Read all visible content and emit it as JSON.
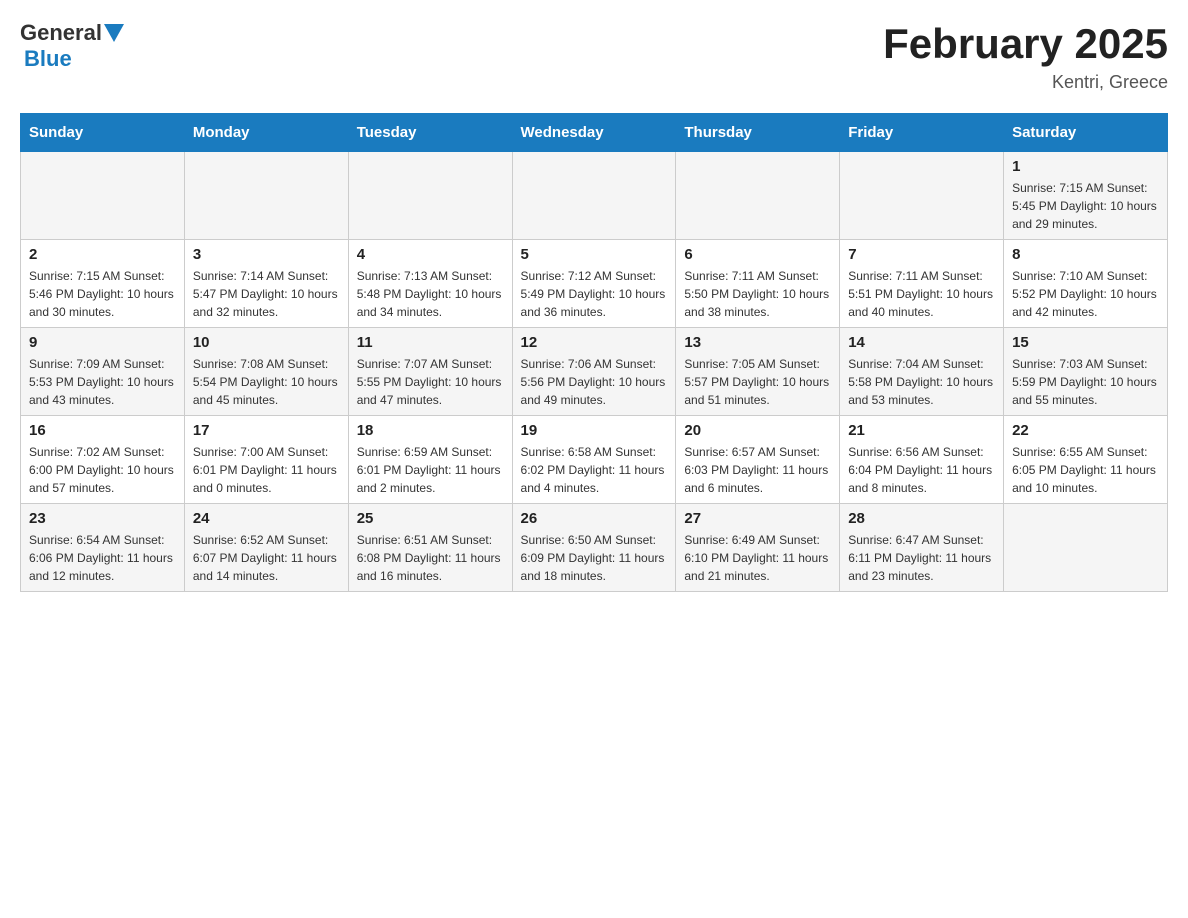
{
  "header": {
    "logo": {
      "text_general": "General",
      "text_blue": "Blue",
      "arrow": "▲"
    },
    "title": "February 2025",
    "location": "Kentri, Greece"
  },
  "calendar": {
    "days_of_week": [
      "Sunday",
      "Monday",
      "Tuesday",
      "Wednesday",
      "Thursday",
      "Friday",
      "Saturday"
    ],
    "weeks": [
      {
        "days": [
          {
            "number": "",
            "info": ""
          },
          {
            "number": "",
            "info": ""
          },
          {
            "number": "",
            "info": ""
          },
          {
            "number": "",
            "info": ""
          },
          {
            "number": "",
            "info": ""
          },
          {
            "number": "",
            "info": ""
          },
          {
            "number": "1",
            "info": "Sunrise: 7:15 AM\nSunset: 5:45 PM\nDaylight: 10 hours and 29 minutes."
          }
        ]
      },
      {
        "days": [
          {
            "number": "2",
            "info": "Sunrise: 7:15 AM\nSunset: 5:46 PM\nDaylight: 10 hours and 30 minutes."
          },
          {
            "number": "3",
            "info": "Sunrise: 7:14 AM\nSunset: 5:47 PM\nDaylight: 10 hours and 32 minutes."
          },
          {
            "number": "4",
            "info": "Sunrise: 7:13 AM\nSunset: 5:48 PM\nDaylight: 10 hours and 34 minutes."
          },
          {
            "number": "5",
            "info": "Sunrise: 7:12 AM\nSunset: 5:49 PM\nDaylight: 10 hours and 36 minutes."
          },
          {
            "number": "6",
            "info": "Sunrise: 7:11 AM\nSunset: 5:50 PM\nDaylight: 10 hours and 38 minutes."
          },
          {
            "number": "7",
            "info": "Sunrise: 7:11 AM\nSunset: 5:51 PM\nDaylight: 10 hours and 40 minutes."
          },
          {
            "number": "8",
            "info": "Sunrise: 7:10 AM\nSunset: 5:52 PM\nDaylight: 10 hours and 42 minutes."
          }
        ]
      },
      {
        "days": [
          {
            "number": "9",
            "info": "Sunrise: 7:09 AM\nSunset: 5:53 PM\nDaylight: 10 hours and 43 minutes."
          },
          {
            "number": "10",
            "info": "Sunrise: 7:08 AM\nSunset: 5:54 PM\nDaylight: 10 hours and 45 minutes."
          },
          {
            "number": "11",
            "info": "Sunrise: 7:07 AM\nSunset: 5:55 PM\nDaylight: 10 hours and 47 minutes."
          },
          {
            "number": "12",
            "info": "Sunrise: 7:06 AM\nSunset: 5:56 PM\nDaylight: 10 hours and 49 minutes."
          },
          {
            "number": "13",
            "info": "Sunrise: 7:05 AM\nSunset: 5:57 PM\nDaylight: 10 hours and 51 minutes."
          },
          {
            "number": "14",
            "info": "Sunrise: 7:04 AM\nSunset: 5:58 PM\nDaylight: 10 hours and 53 minutes."
          },
          {
            "number": "15",
            "info": "Sunrise: 7:03 AM\nSunset: 5:59 PM\nDaylight: 10 hours and 55 minutes."
          }
        ]
      },
      {
        "days": [
          {
            "number": "16",
            "info": "Sunrise: 7:02 AM\nSunset: 6:00 PM\nDaylight: 10 hours and 57 minutes."
          },
          {
            "number": "17",
            "info": "Sunrise: 7:00 AM\nSunset: 6:01 PM\nDaylight: 11 hours and 0 minutes."
          },
          {
            "number": "18",
            "info": "Sunrise: 6:59 AM\nSunset: 6:01 PM\nDaylight: 11 hours and 2 minutes."
          },
          {
            "number": "19",
            "info": "Sunrise: 6:58 AM\nSunset: 6:02 PM\nDaylight: 11 hours and 4 minutes."
          },
          {
            "number": "20",
            "info": "Sunrise: 6:57 AM\nSunset: 6:03 PM\nDaylight: 11 hours and 6 minutes."
          },
          {
            "number": "21",
            "info": "Sunrise: 6:56 AM\nSunset: 6:04 PM\nDaylight: 11 hours and 8 minutes."
          },
          {
            "number": "22",
            "info": "Sunrise: 6:55 AM\nSunset: 6:05 PM\nDaylight: 11 hours and 10 minutes."
          }
        ]
      },
      {
        "days": [
          {
            "number": "23",
            "info": "Sunrise: 6:54 AM\nSunset: 6:06 PM\nDaylight: 11 hours and 12 minutes."
          },
          {
            "number": "24",
            "info": "Sunrise: 6:52 AM\nSunset: 6:07 PM\nDaylight: 11 hours and 14 minutes."
          },
          {
            "number": "25",
            "info": "Sunrise: 6:51 AM\nSunset: 6:08 PM\nDaylight: 11 hours and 16 minutes."
          },
          {
            "number": "26",
            "info": "Sunrise: 6:50 AM\nSunset: 6:09 PM\nDaylight: 11 hours and 18 minutes."
          },
          {
            "number": "27",
            "info": "Sunrise: 6:49 AM\nSunset: 6:10 PM\nDaylight: 11 hours and 21 minutes."
          },
          {
            "number": "28",
            "info": "Sunrise: 6:47 AM\nSunset: 6:11 PM\nDaylight: 11 hours and 23 minutes."
          },
          {
            "number": "",
            "info": ""
          }
        ]
      }
    ]
  }
}
